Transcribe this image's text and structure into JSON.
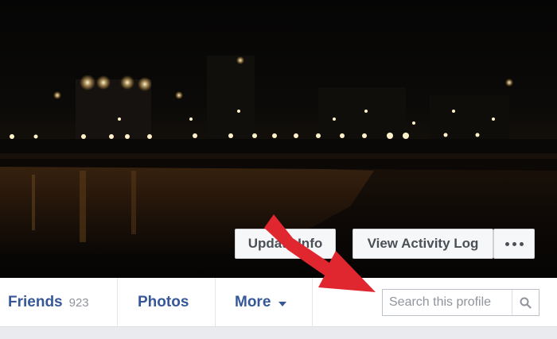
{
  "cover": {
    "update_info_label": "Update Info",
    "view_activity_log_label": "View Activity Log"
  },
  "nav": {
    "friends_label": "Friends",
    "friends_count": "923",
    "photos_label": "Photos",
    "more_label": "More"
  },
  "search": {
    "placeholder": "Search this profile"
  },
  "colors": {
    "link_blue": "#365899",
    "arrow_red": "#e0262e",
    "button_bg": "#f6f7f9"
  },
  "icons": {
    "overflow": "more-dots-icon",
    "search": "search-icon",
    "caret": "caret-down-icon",
    "annotation": "red-arrow"
  }
}
